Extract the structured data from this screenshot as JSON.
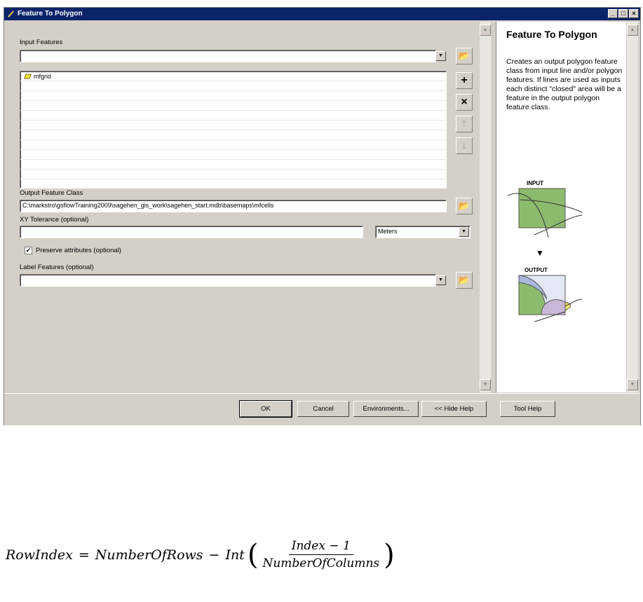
{
  "window": {
    "title": "Feature To Polygon"
  },
  "input_features": {
    "label": "Input Features",
    "value": "",
    "items": [
      "mfgrid"
    ]
  },
  "output_feature_class": {
    "label": "Output Feature Class",
    "value": "C:\\markstro\\gsflowTraining2009\\sagehen_gis_work\\sagehen_start.mdb\\basemaps\\mfcells"
  },
  "xy_tolerance": {
    "label": "XY Tolerance (optional)",
    "value": "",
    "units": "Meters"
  },
  "preserve_attributes": {
    "label": "Preserve attributes (optional)",
    "checked": true
  },
  "label_features": {
    "label": "Label Features (optional)",
    "value": ""
  },
  "help": {
    "title": "Feature To Polygon",
    "text": "Creates an output polygon feature class from input line and/or polygon features. If lines are used as inputs each distinct \"closed\" area will be a feature in the output polygon feature class.",
    "input_label": "INPUT",
    "output_label": "OUTPUT"
  },
  "buttons": {
    "ok": "OK",
    "cancel": "Cancel",
    "environments": "Environments...",
    "hide_help": "<< Hide Help",
    "tool_help": "Tool Help"
  },
  "formula": {
    "lhs": "RowIndex",
    "eq": "=",
    "minuend": "NumberOfRows",
    "minus": "−",
    "func": "Int",
    "numerator": "Index − 1",
    "denominator": "NumberOfColumns"
  },
  "colors": {
    "title_bar": "#0a246a",
    "dialog": "#d4d0c8",
    "polygon_green": "#8dbb6e",
    "polygon_blue": "#a9b6dd",
    "polygon_purple": "#c9b7d8",
    "polygon_yellow": "#f0ec6e"
  }
}
